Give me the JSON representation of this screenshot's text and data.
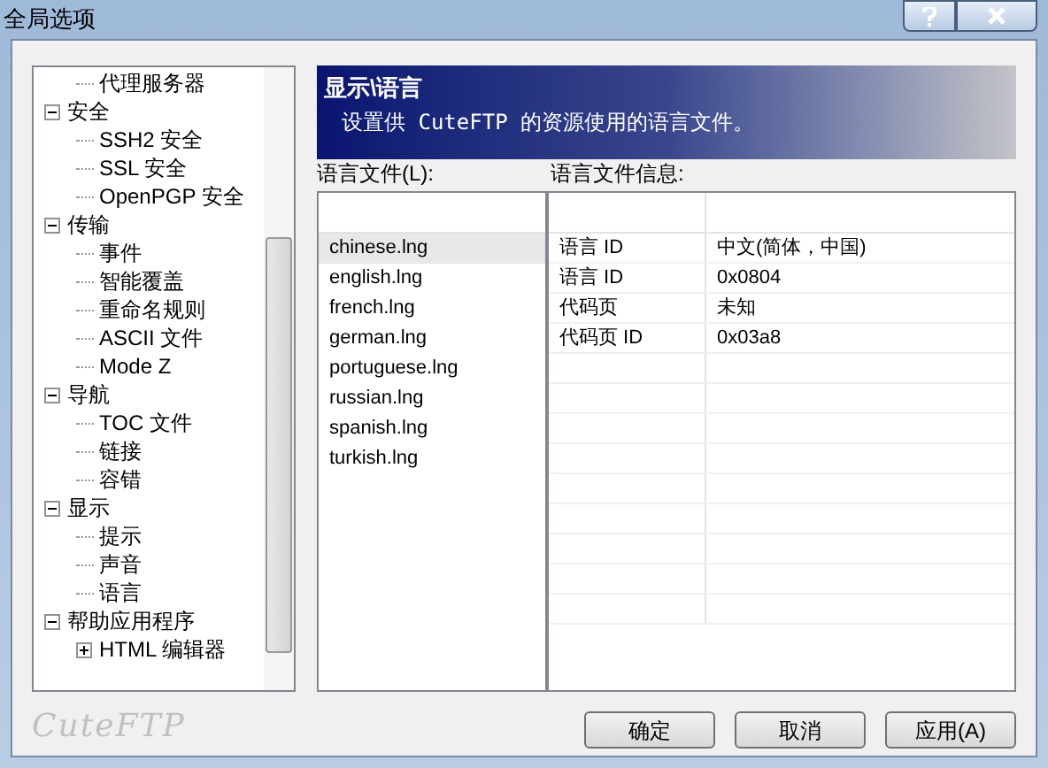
{
  "window": {
    "title": "全局选项"
  },
  "tree": [
    {
      "children": [
        {
          "label": "代理服务器"
        }
      ]
    },
    {
      "label": "安全",
      "expanded": true,
      "children": [
        {
          "label": "SSH2 安全"
        },
        {
          "label": "SSL 安全"
        },
        {
          "label": "OpenPGP 安全"
        }
      ]
    },
    {
      "label": "传输",
      "expanded": true,
      "children": [
        {
          "label": "事件"
        },
        {
          "label": "智能覆盖"
        },
        {
          "label": "重命名规则"
        },
        {
          "label": "ASCII 文件"
        },
        {
          "label": "Mode Z"
        }
      ]
    },
    {
      "label": "导航",
      "expanded": true,
      "children": [
        {
          "label": "TOC 文件"
        },
        {
          "label": "链接"
        },
        {
          "label": "容错"
        }
      ]
    },
    {
      "label": "显示",
      "expanded": true,
      "children": [
        {
          "label": "提示"
        },
        {
          "label": "声音"
        },
        {
          "label": "语言"
        }
      ]
    },
    {
      "label": "帮助应用程序",
      "expanded": true,
      "children": [
        {
          "label": "HTML 编辑器",
          "expanded": false
        }
      ]
    }
  ],
  "header": {
    "title": "显示\\语言",
    "subtitle": "设置供 CuteFTP 的资源使用的语言文件。"
  },
  "language_files": {
    "label": "语言文件(L):",
    "items": [
      {
        "name": "chinese.lng",
        "selected": true
      },
      {
        "name": "english.lng",
        "selected": false
      },
      {
        "name": "french.lng",
        "selected": false
      },
      {
        "name": "german.lng",
        "selected": false
      },
      {
        "name": "portuguese.lng",
        "selected": false
      },
      {
        "name": "russian.lng",
        "selected": false
      },
      {
        "name": "spanish.lng",
        "selected": false
      },
      {
        "name": "turkish.lng",
        "selected": false
      }
    ]
  },
  "file_info": {
    "label": "语言文件信息:",
    "rows": [
      [
        "语言 ID",
        "中文(简体，中国)"
      ],
      [
        "语言 ID",
        "0x0804"
      ],
      [
        "代码页",
        "未知"
      ],
      [
        "代码页 ID",
        "0x03a8"
      ]
    ]
  },
  "logo": "CuteFTP",
  "buttons": [
    "确定",
    "取消",
    "应用(A)"
  ]
}
